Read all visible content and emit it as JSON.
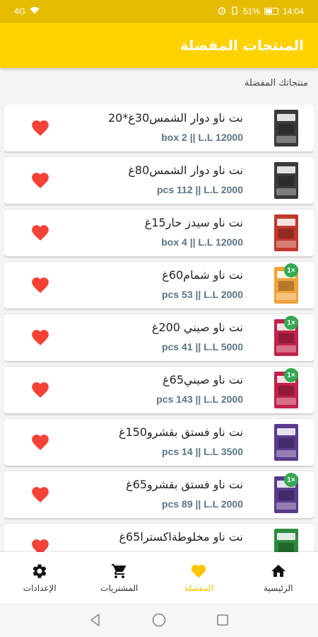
{
  "status": {
    "signal": "4G",
    "battery": "51%",
    "time": "14:04"
  },
  "app_bar": {
    "title": "المنتجات المفضلة"
  },
  "section_label": "منتجاتك المفضلة",
  "products": [
    {
      "name": "نت ناو دوار الشمس30غ*20",
      "price": "box 2 || L.L 12000",
      "thumb_color": "#3a3a3a",
      "badge": ""
    },
    {
      "name": "نت ناو دوار الشمس80غ",
      "price": "pcs 112 || L.L 2000",
      "thumb_color": "#3a3a3a",
      "badge": ""
    },
    {
      "name": "نت ناو سيدز حار15غ",
      "price": "box 4 || L.L 12000",
      "thumb_color": "#c0392b",
      "badge": ""
    },
    {
      "name": "نت ناو شمام60غ",
      "price": "pcs 53 || L.L 2000",
      "thumb_color": "#f0a33a",
      "badge": "1×"
    },
    {
      "name": "نت ناو صيني 200غ",
      "price": "pcs 41 || L.L 5000",
      "thumb_color": "#c0234a",
      "badge": "1×"
    },
    {
      "name": "نت ناو صيني65غ",
      "price": "pcs 143 || L.L 2000",
      "thumb_color": "#c0234a",
      "badge": "1×"
    },
    {
      "name": "نت ناو فستق بقشرو150غ",
      "price": "pcs 14 || L.L 3500",
      "thumb_color": "#5b3a8c",
      "badge": ""
    },
    {
      "name": "نت ناو فستق بقشرو65غ",
      "price": "pcs 89 || L.L 2000",
      "thumb_color": "#5b3a8c",
      "badge": "1×"
    },
    {
      "name": "نت ناو مخلوطةاكسترا65غ",
      "price": "",
      "thumb_color": "#2e8b3e",
      "badge": ""
    }
  ],
  "nav": {
    "home": "الرئيسية",
    "favorites": "المفضلة",
    "purchases": "المشتريات",
    "settings": "الإعدادات"
  },
  "colors": {
    "primary": "#ffd200",
    "status": "#e6bc00",
    "heart": "#f44336",
    "badge": "#34a853"
  }
}
